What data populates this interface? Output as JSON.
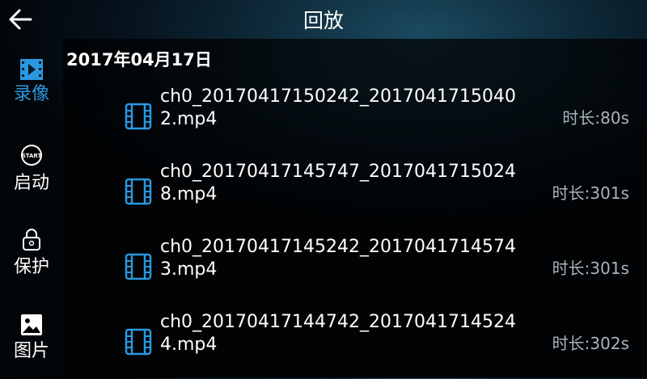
{
  "header": {
    "title": "回放",
    "back_icon": "arrow-left-icon"
  },
  "sidebar": {
    "items": [
      {
        "label": "录像",
        "icon": "film-icon",
        "active": true
      },
      {
        "label": "启动",
        "icon": "start-icon",
        "icon_text": "START",
        "active": false
      },
      {
        "label": "保护",
        "icon": "lock-icon",
        "active": false
      },
      {
        "label": "图片",
        "icon": "image-icon",
        "active": false
      }
    ]
  },
  "content": {
    "date": "2017年04月17日",
    "files": [
      {
        "name": "ch0_20170417150242_20170417150402.mp4",
        "duration": "时长:80s"
      },
      {
        "name": "ch0_20170417145747_20170417150248.mp4",
        "duration": "时长:301s"
      },
      {
        "name": "ch0_20170417145242_20170417145743.mp4",
        "duration": "时长:301s"
      },
      {
        "name": "ch0_20170417144742_20170417145244.mp4",
        "duration": "时长:302s"
      }
    ]
  },
  "colors": {
    "accent": "#2a98e0",
    "duration_text": "#aab4ba"
  }
}
